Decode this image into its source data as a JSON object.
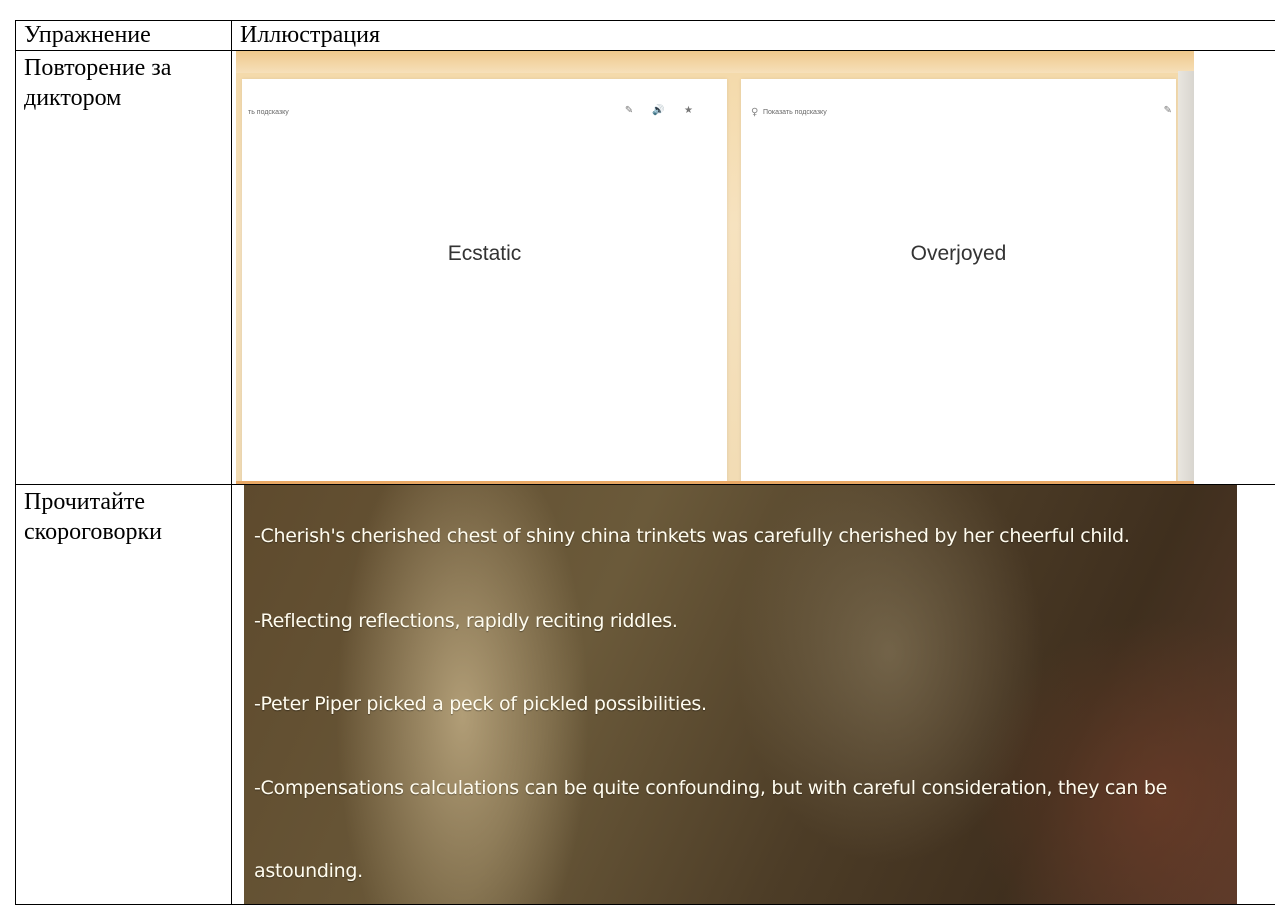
{
  "table": {
    "header": {
      "col1": "Упражнение",
      "col2": "Иллюстрация"
    },
    "rows": [
      {
        "exercise": "Повторение за диктором",
        "illustration": {
          "cards": [
            {
              "hint": "ть подсказку",
              "word": "Ecstatic",
              "tools": "✎ 🔊 ★"
            },
            {
              "hint": "Показать подсказку",
              "word": "Overjoyed",
              "tools": "✎"
            }
          ]
        }
      },
      {
        "exercise": "Прочитайте скороговорки",
        "illustration": {
          "lines": [
            "-Cherish's cherished chest of shiny china trinkets was carefully cherished by her cheerful child.",
            "-Reflecting reflections, rapidly reciting riddles.",
            "-Peter Piper picked a peck of pickled possibilities.",
            "-Compensations calculations can be quite confounding, but with careful consideration, they can be",
            "astounding."
          ]
        }
      }
    ]
  }
}
